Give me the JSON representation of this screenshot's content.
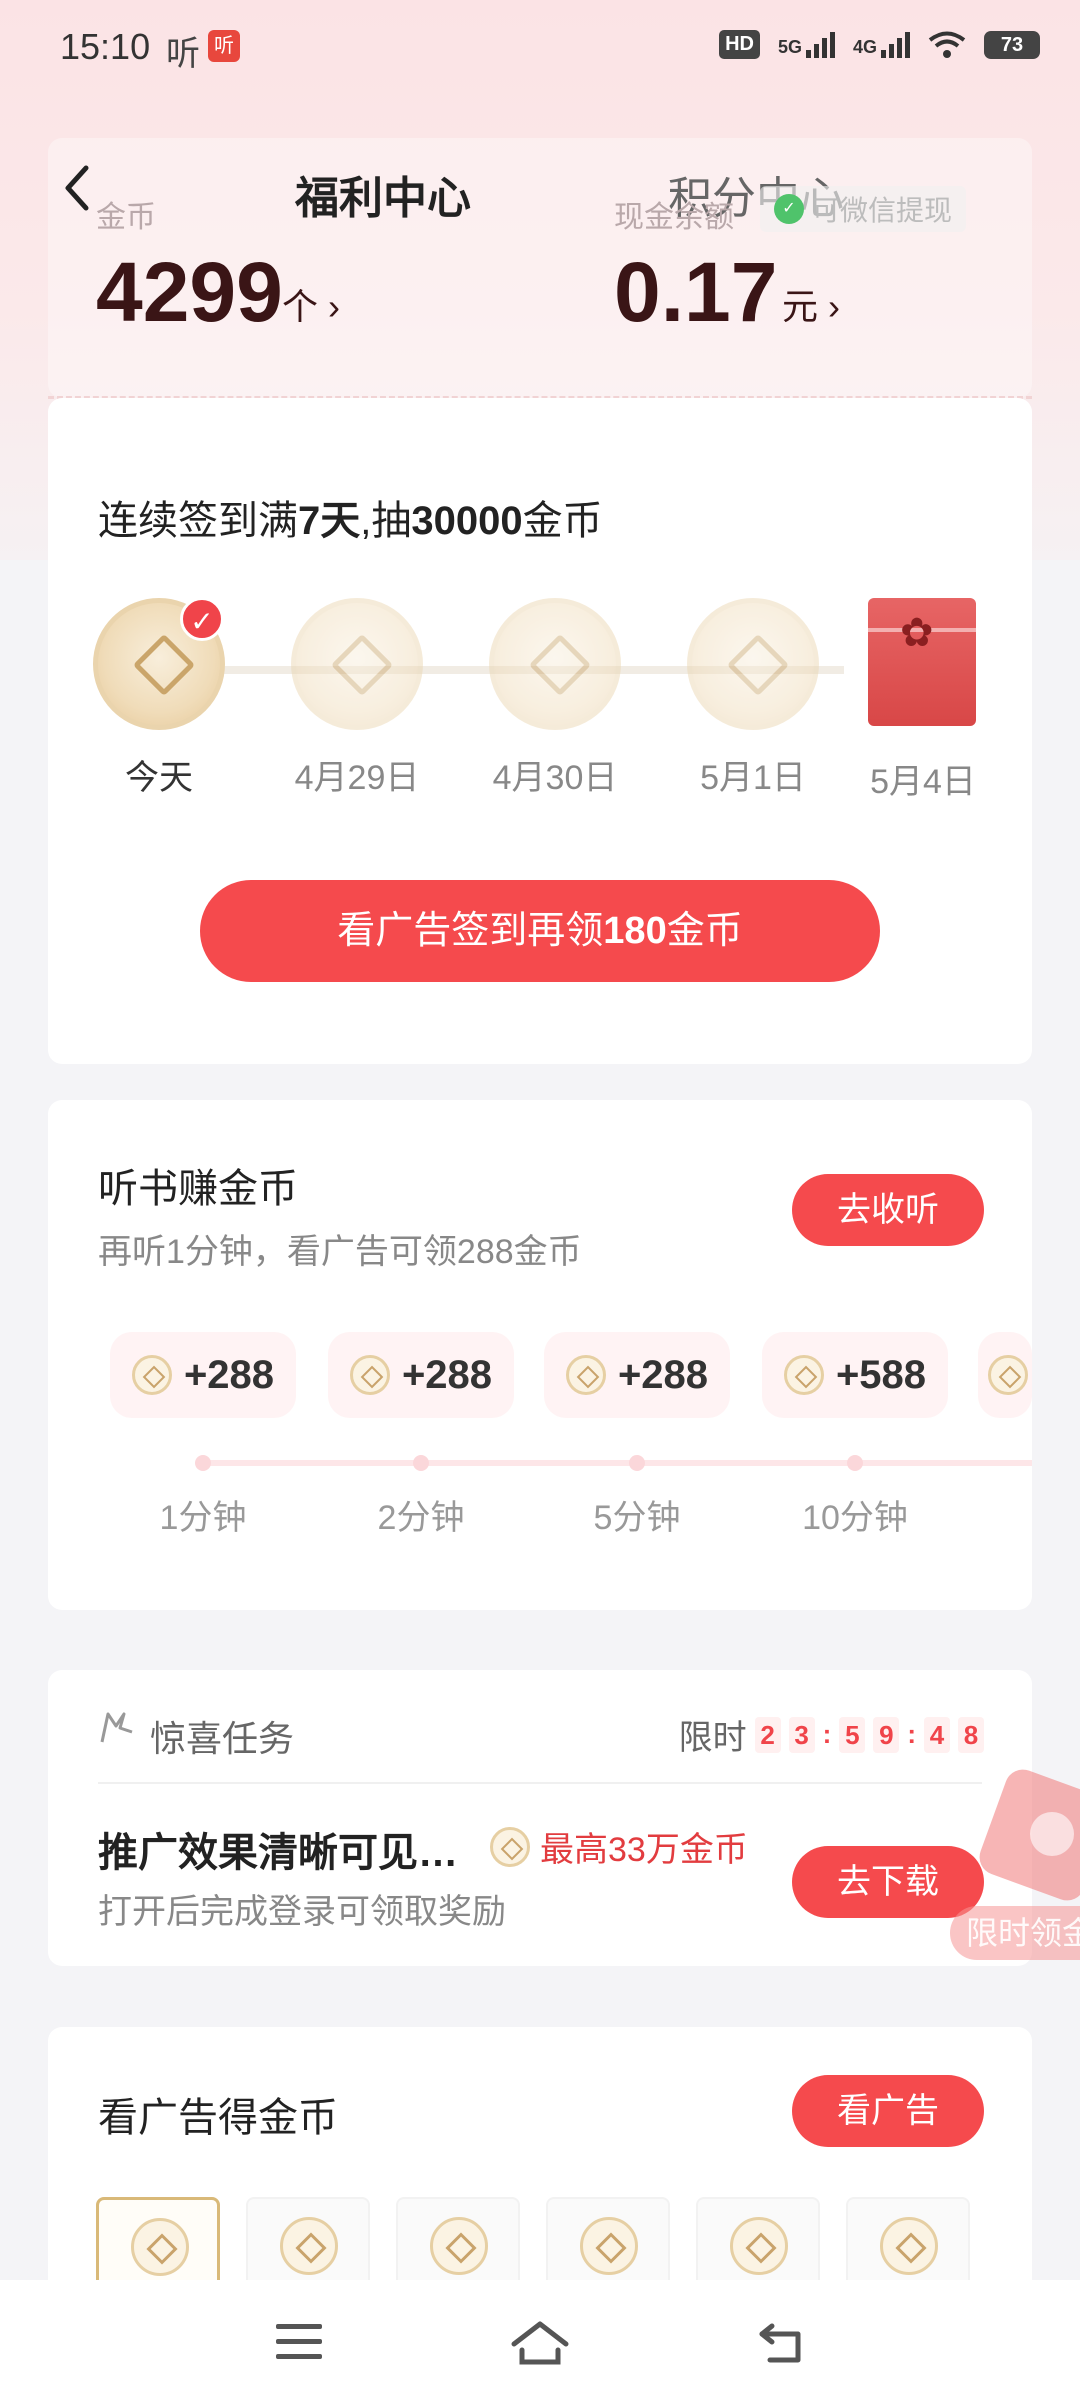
{
  "status_bar": {
    "time": "15:10",
    "app_glyph": "听",
    "app_badge": "听",
    "hd": "HD",
    "net1": "5G",
    "net2": "4G",
    "battery": "73"
  },
  "header": {
    "tabs": [
      "福利中心",
      "积分中心"
    ],
    "coin_label": "金币",
    "coin_value": "4299",
    "coin_unit": "个",
    "cash_label": "现金余额",
    "cash_value": "0.17",
    "cash_unit": "元",
    "withdraw_label": "可微信提现"
  },
  "checkin": {
    "title_pre": "连续签到满",
    "title_days": "7天",
    "title_mid": ",抽",
    "title_amount": "30000",
    "title_post": "金币",
    "days": [
      "今天",
      "4月29日",
      "4月30日",
      "5月1日",
      "5月4日"
    ],
    "button_pre": "看广告签到再领",
    "button_amount": "180",
    "button_post": "金币"
  },
  "listen": {
    "title": "听书赚金币",
    "subtitle": "再听1分钟，看广告可领288金币",
    "button": "去收听",
    "rewards": [
      "+288",
      "+288",
      "+288",
      "+588"
    ],
    "minutes": [
      "1分钟",
      "2分钟",
      "5分钟",
      "10分钟"
    ]
  },
  "surprise": {
    "title": "惊喜任务",
    "limit_label": "限时",
    "countdown": [
      "2",
      "3",
      "5",
      "9",
      "4",
      "8"
    ],
    "task_title": "推广效果清晰可见…",
    "task_reward": "最高33万金币",
    "task_sub": "打开后完成登录可领取奖励",
    "button": "去下载",
    "float_label": "限时领金"
  },
  "ads": {
    "title": "看广告得金币",
    "button": "看广告"
  },
  "icons": [
    "back-arrow-icon",
    "wechat-icon",
    "check-icon",
    "gift-box-icon",
    "coin-icon",
    "surprise-task-icon",
    "menu-icon",
    "home-icon",
    "back-icon"
  ],
  "colors": {
    "accent": "#f54a4d",
    "gold": "#caa56a",
    "text_dark": "#3a1516"
  }
}
